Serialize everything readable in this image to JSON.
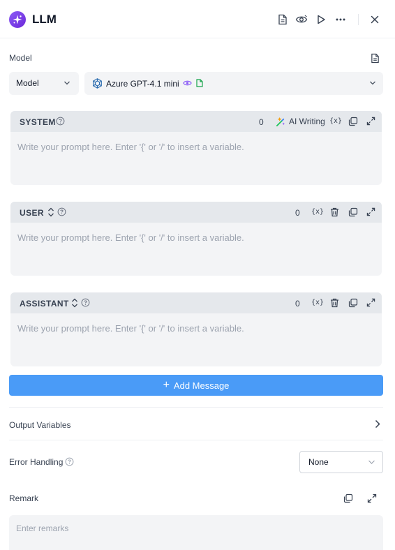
{
  "header": {
    "title": "LLM"
  },
  "model_section": {
    "label": "Model",
    "type_select": "Model",
    "model_name": "Azure GPT-4.1 mini"
  },
  "prompts": {
    "system": {
      "role": "SYSTEM",
      "count": "0",
      "ai_writing": "AI Writing",
      "var_label": "{x}",
      "placeholder": "Write your prompt here. Enter '{' or '/' to insert a variable."
    },
    "user": {
      "role": "USER",
      "count": "0",
      "var_label": "{x}",
      "placeholder": "Write your prompt here. Enter '{' or '/' to insert a variable."
    },
    "assistant": {
      "role": "ASSISTANT",
      "count": "0",
      "var_label": "{x}",
      "placeholder": "Write your prompt here. Enter '{' or '/' to insert a variable."
    }
  },
  "add_message": {
    "plus": "+",
    "label": "Add Message"
  },
  "output_variables": {
    "label": "Output Variables"
  },
  "error_handling": {
    "label": "Error Handling",
    "value": "None"
  },
  "remark": {
    "label": "Remark",
    "placeholder": "Enter remarks"
  },
  "colors": {
    "accent": "#4a9bf7",
    "brand": "#7c3aed",
    "bar_bg": "#e5e8ec",
    "field_bg": "#f3f4f6"
  },
  "icons": [
    "sparkle-icon",
    "doc-icon",
    "eye-icon",
    "play-icon",
    "more-icon",
    "close-icon",
    "openai-icon",
    "chevron-down-icon",
    "help-icon",
    "ai-writing-icon",
    "variable-icon",
    "copy-icon",
    "expand-icon",
    "sort-icon",
    "trash-icon",
    "chevron-right-icon"
  ]
}
